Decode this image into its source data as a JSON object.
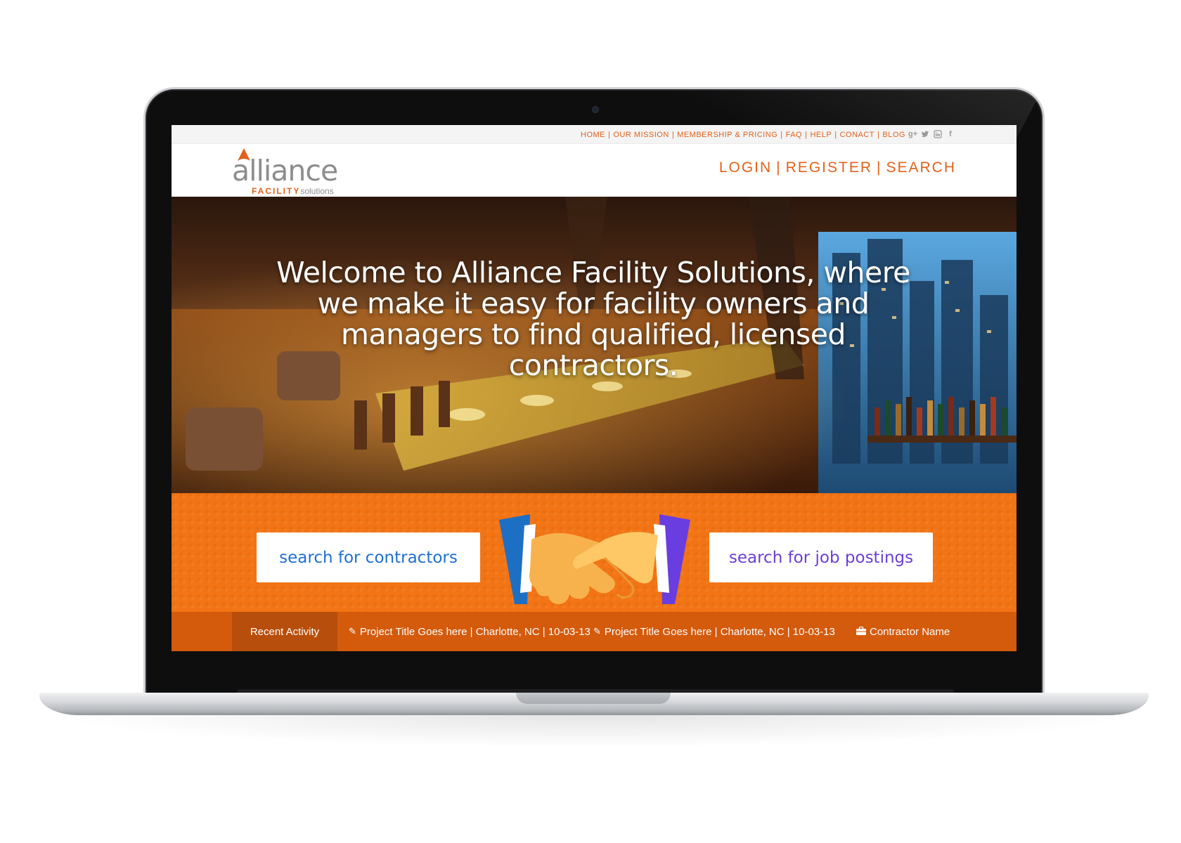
{
  "util_nav": {
    "items": [
      "HOME",
      "OUR MISSION",
      "MEMBERSHIP & PRICING",
      "FAQ",
      "HELP",
      "CONACT",
      "BLOG"
    ],
    "separator": "|",
    "social_icons": [
      "google-plus-icon",
      "twitter-icon",
      "linkedin-icon",
      "facebook-icon"
    ]
  },
  "logo": {
    "word": "alliance",
    "sub_bold": "FACILITY",
    "sub_light": "solutions"
  },
  "auth": {
    "login": "LOGIN",
    "register": "REGISTER",
    "search": "SEARCH",
    "separator": "|"
  },
  "hero": {
    "headline": "Welcome to Alliance Facility Solutions, where we make it easy for facility owners and managers to find qualified, licensed contractors."
  },
  "cta": {
    "left_label": "search for contractors",
    "right_label": "search for job postings"
  },
  "activity": {
    "label": "Recent Activity",
    "items": [
      {
        "icon": "edit-icon",
        "text": "Project Title Goes here | Charlotte, NC | 10-03-13"
      },
      {
        "icon": "edit-icon",
        "text": "Project Title Goes here | Charlotte, NC | 10-03-13"
      },
      {
        "icon": "briefcase-icon",
        "text": "Contractor Name"
      }
    ]
  },
  "colors": {
    "brand_orange": "#e1611b",
    "band_orange": "#f27414",
    "activity_bar": "#d45a0c",
    "left_cta_text": "#1f6fd0",
    "right_cta_text": "#6b3fd4"
  }
}
